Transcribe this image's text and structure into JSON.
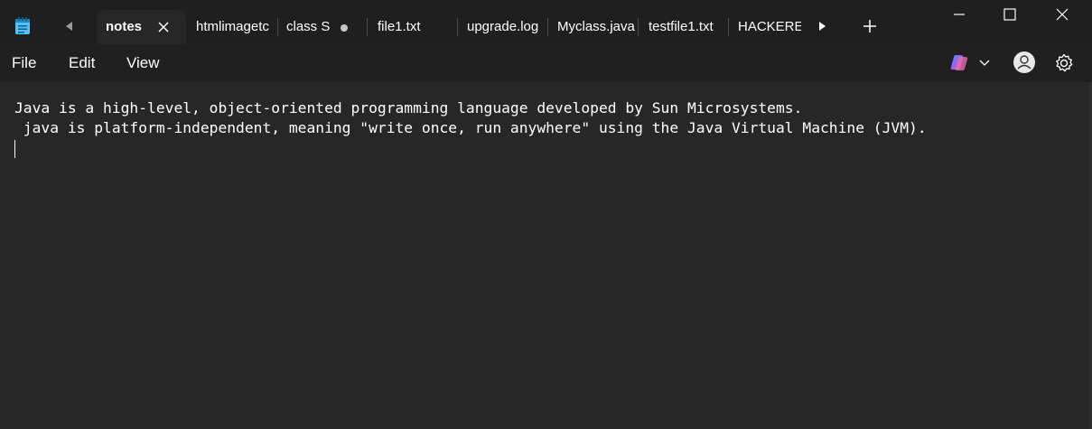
{
  "app": {
    "icon": "notepad-icon"
  },
  "tabs": [
    {
      "label": "notes",
      "active": true,
      "control": "close-icon"
    },
    {
      "label": "htmlimagetc"
    },
    {
      "label": "class S",
      "control": "unsaved-dot"
    },
    {
      "label": "file1.txt"
    },
    {
      "label": "upgrade.log"
    },
    {
      "label": "Myclass.java"
    },
    {
      "label": "testfile1.txt"
    },
    {
      "label": "HACKEREA"
    }
  ],
  "menu": {
    "file": "File",
    "edit": "Edit",
    "view": "View"
  },
  "editor": {
    "lines": [
      "Java is a high-level, object-oriented programming language developed by Sun Microsystems.",
      " java is platform-independent, meaning \"write once, run anywhere\" using the Java Virtual Machine (JVM)."
    ]
  },
  "colors": {
    "titlebar": "#1f1f1f",
    "menubar": "#202020",
    "editor_bg": "#272727",
    "text": "#ffffff",
    "app_icon": "#4fc3f7"
  },
  "icons": [
    "notepad-icon",
    "scroll-left-icon",
    "close-icon",
    "unsaved-dot-icon",
    "scroll-right-icon",
    "plus-icon",
    "minimize-icon",
    "maximize-icon",
    "close-window-icon",
    "copilot-icon",
    "chevron-down-icon",
    "avatar-icon",
    "gear-icon"
  ]
}
